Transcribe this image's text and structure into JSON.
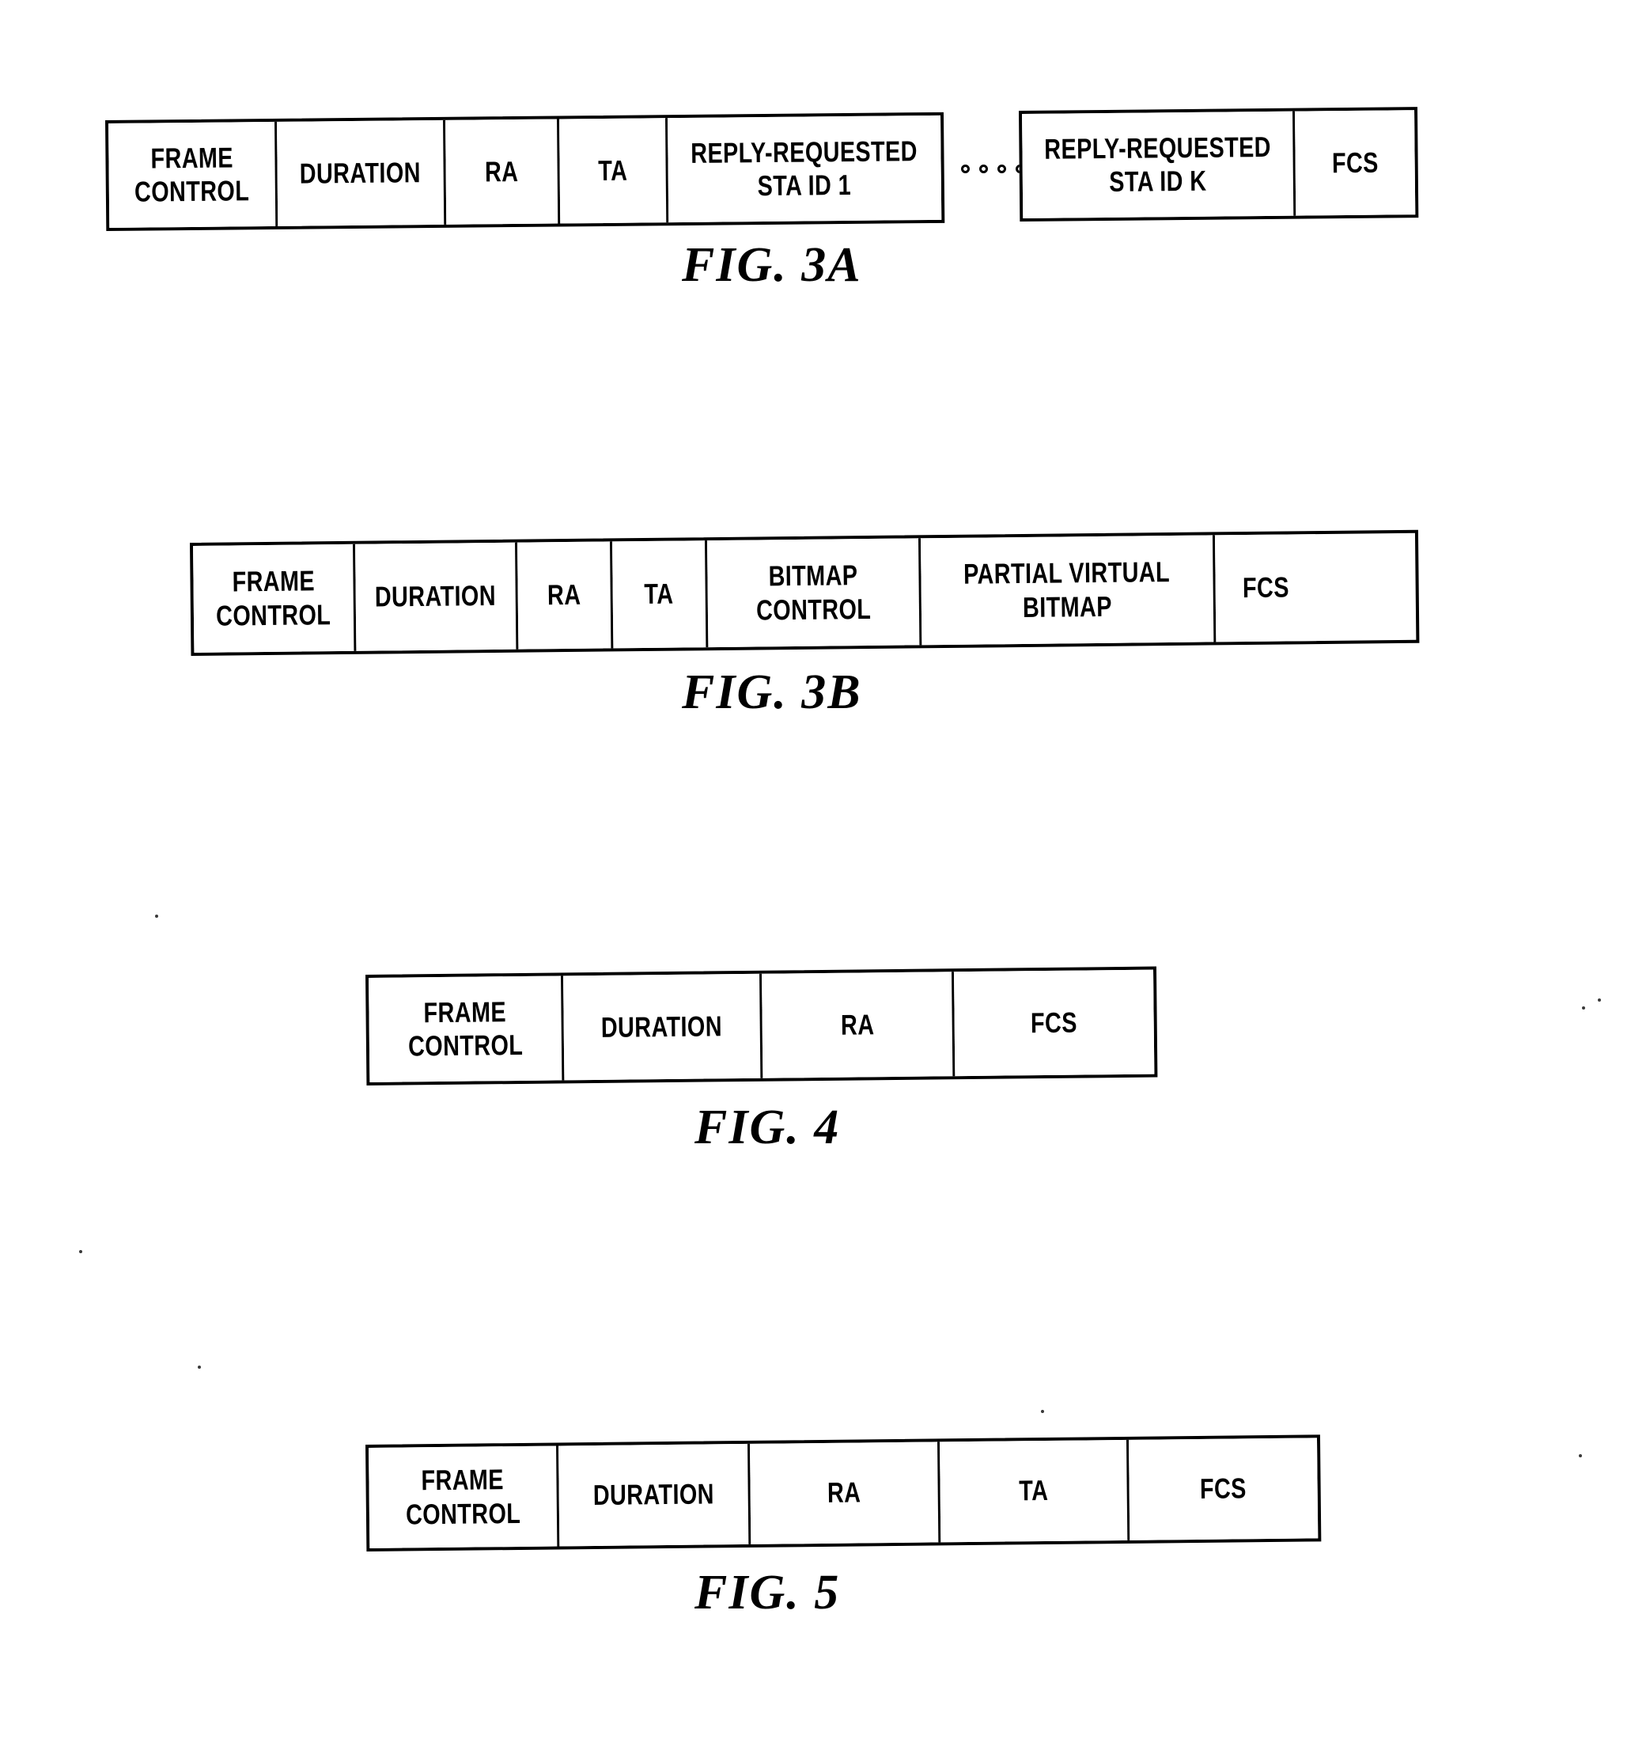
{
  "document": {
    "type": "patent-drawing-sheet",
    "figures": [
      {
        "id": "fig-3a",
        "caption": "FIG. 3A",
        "fragments": [
          {
            "id": "fig-3a-part-1",
            "cells": [
              {
                "lines": [
                  "FRAME",
                  "CONTROL"
                ]
              },
              {
                "lines": [
                  "DURATION"
                ]
              },
              {
                "lines": [
                  "RA"
                ]
              },
              {
                "lines": [
                  "TA"
                ]
              },
              {
                "lines": [
                  "REPLY-REQUESTED",
                  "STA ID 1"
                ]
              }
            ]
          },
          {
            "id": "fig-3a-part-2",
            "cells": [
              {
                "lines": [
                  "REPLY-REQUESTED",
                  "STA ID K"
                ]
              },
              {
                "lines": [
                  "FCS"
                ]
              }
            ]
          }
        ],
        "separator": {
          "kind": "ellipsis",
          "dot_count": 4
        }
      },
      {
        "id": "fig-3b",
        "caption": "FIG. 3B",
        "fragments": [
          {
            "id": "fig-3b-part-1",
            "cells": [
              {
                "lines": [
                  "FRAME",
                  "CONTROL"
                ]
              },
              {
                "lines": [
                  "DURATION"
                ]
              },
              {
                "lines": [
                  "RA"
                ]
              },
              {
                "lines": [
                  "TA"
                ]
              },
              {
                "lines": [
                  "BITMAP",
                  "CONTROL"
                ]
              },
              {
                "lines": [
                  "PARTIAL VIRTUAL",
                  "BITMAP"
                ]
              },
              {
                "lines": [
                  "FCS"
                ]
              }
            ]
          }
        ]
      },
      {
        "id": "fig-4",
        "caption": "FIG. 4",
        "fragments": [
          {
            "id": "fig-4-part-1",
            "cells": [
              {
                "lines": [
                  "FRAME",
                  "CONTROL"
                ]
              },
              {
                "lines": [
                  "DURATION"
                ]
              },
              {
                "lines": [
                  "RA"
                ]
              },
              {
                "lines": [
                  "FCS"
                ]
              }
            ]
          }
        ]
      },
      {
        "id": "fig-5",
        "caption": "FIG. 5",
        "fragments": [
          {
            "id": "fig-5-part-1",
            "cells": [
              {
                "lines": [
                  "FRAME",
                  "CONTROL"
                ]
              },
              {
                "lines": [
                  "DURATION"
                ]
              },
              {
                "lines": [
                  "RA"
                ]
              },
              {
                "lines": [
                  "TA"
                ]
              },
              {
                "lines": [
                  "FCS"
                ]
              }
            ]
          }
        ]
      }
    ]
  },
  "colors": {
    "ink": "#000000",
    "paper": "#ffffff"
  }
}
